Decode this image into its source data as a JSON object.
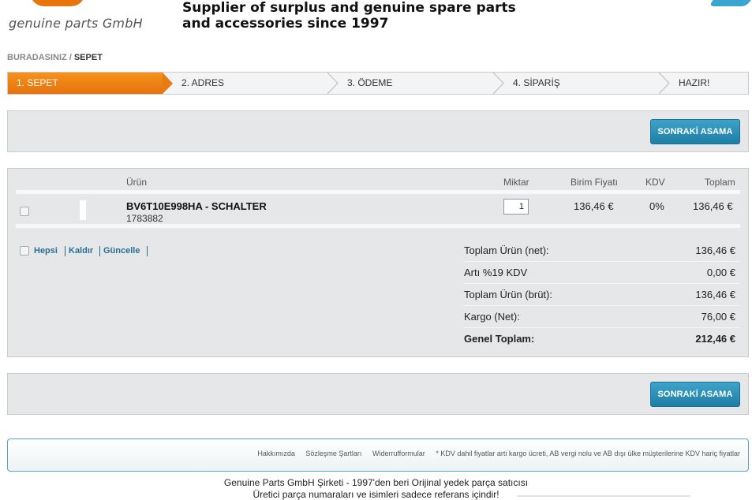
{
  "header": {
    "logo_text": "genuine parts GmbH",
    "tagline_line1": "Supplier of surplus and genuine spare parts",
    "tagline_line2": "and accessories since 1997"
  },
  "breadcrumb": {
    "first": "BURADASINIZ",
    "separator": "/",
    "current": "SEPET"
  },
  "steps": [
    {
      "label": "1. SEPET",
      "active": true
    },
    {
      "label": "2. ADRES",
      "active": false
    },
    {
      "label": "3. ÖDEME",
      "active": false
    },
    {
      "label": "4. SİPARİŞ",
      "active": false
    },
    {
      "label": "HAZIR!",
      "active": false
    }
  ],
  "next_button_label": "SONRAKİ ASAMA",
  "cart": {
    "columns": {
      "product": "Ürün",
      "quantity": "Miktar",
      "unit_price": "Birim Fiyatı",
      "vat": "KDV",
      "total": "Toplam"
    },
    "items": [
      {
        "name": "BV6T10E998HA - SCHALTER",
        "code": "1783882",
        "quantity": "1",
        "unit_price": "136,46 €",
        "vat": "0%",
        "total": "136,46 €"
      }
    ],
    "actions": {
      "all": "Hepsi",
      "remove": "Kaldır",
      "update": "Güncelle"
    },
    "summary": [
      {
        "label": "Toplam Ürün (net):",
        "value": "136,46 €"
      },
      {
        "label": "Artı %19 KDV",
        "value": "0,00 €"
      },
      {
        "label": "Toplam Ürün (brüt):",
        "value": "136,46 €"
      },
      {
        "label": "Kargo (Net):",
        "value": "76,00 €"
      },
      {
        "label": "Genel Toplam:",
        "value": "212,46 €"
      }
    ]
  },
  "footer": {
    "links": [
      "Hakkımızda",
      "Sözleşme Şartları",
      "Widerrufformular"
    ],
    "note": "* KDV dahil fiyatlar arti kargo ücreti, AB vergi nolu ve AB dışı ülke müşterilerine KDV hariç fiyatlar",
    "company_line": "Genuine Parts GmbH Şirketi - 1997'den beri Orijinal yedek parça satıcısı",
    "disclaimer": "Üretici parça numaraları ve isimleri sadece referans içindir!"
  },
  "colors": {
    "accent_orange": "#e8740c",
    "button_blue": "#2a8bb5",
    "link_blue": "#2a6f93"
  }
}
